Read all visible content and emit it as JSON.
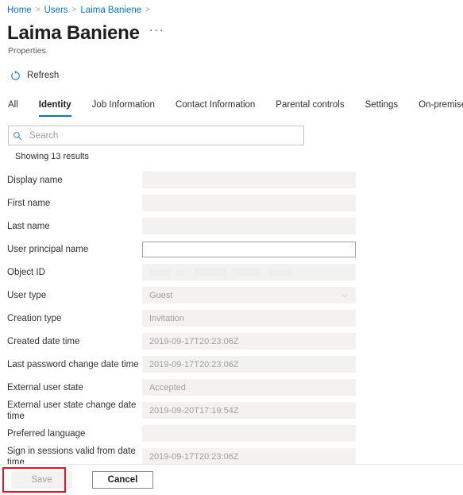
{
  "breadcrumb": {
    "items": [
      "Home",
      "Users",
      "Laima Baniene"
    ],
    "separator": ">"
  },
  "header": {
    "title": "Laima Baniene",
    "subtitle": "Properties",
    "more_menu": "···"
  },
  "command_bar": {
    "refresh_label": "Refresh",
    "refresh_icon": "refresh-icon"
  },
  "tabs": [
    {
      "label": "All",
      "active": false
    },
    {
      "label": "Identity",
      "active": true
    },
    {
      "label": "Job Information",
      "active": false
    },
    {
      "label": "Contact Information",
      "active": false
    },
    {
      "label": "Parental controls",
      "active": false
    },
    {
      "label": "Settings",
      "active": false
    },
    {
      "label": "On-premises",
      "active": false
    }
  ],
  "search": {
    "placeholder": "Search",
    "value": "",
    "icon": "search-icon"
  },
  "results": {
    "count_text": "Showing 13 results"
  },
  "form": {
    "fields": [
      {
        "label": "Display name",
        "value": "",
        "type": "text",
        "disabled": true
      },
      {
        "label": "First name",
        "value": "",
        "type": "text",
        "disabled": true
      },
      {
        "label": "Last name",
        "value": "",
        "type": "text",
        "disabled": true
      },
      {
        "label": "User principal name",
        "value": "",
        "type": "text",
        "disabled": false
      },
      {
        "label": "Object ID",
        "value": "",
        "type": "redacted",
        "disabled": true
      },
      {
        "label": "User type",
        "value": "Guest",
        "type": "select",
        "disabled": true
      },
      {
        "label": "Creation type",
        "value": "Invitation",
        "type": "text",
        "disabled": true
      },
      {
        "label": "Created date time",
        "value": "2019-09-17T20:23:06Z",
        "type": "text",
        "disabled": true
      },
      {
        "label": "Last password change date time",
        "value": "2019-09-17T20:23:06Z",
        "type": "text",
        "disabled": true
      },
      {
        "label": "External user state",
        "value": "Accepted",
        "type": "text",
        "disabled": true
      },
      {
        "label": "External user state change date time",
        "value": "2019-09-20T17:19:54Z",
        "type": "text",
        "disabled": true
      },
      {
        "label": "Preferred language",
        "value": "",
        "type": "text",
        "disabled": true
      },
      {
        "label": "Sign in sessions valid from date time",
        "value": "2019-09-17T20:23:06Z",
        "type": "text",
        "disabled": true
      }
    ]
  },
  "footer": {
    "save_label": "Save",
    "cancel_label": "Cancel",
    "save_disabled": true
  },
  "colors": {
    "accent": "#0078d4",
    "link": "#0078d4",
    "text": "#323130",
    "disabled_text": "#a19f9d",
    "field_bg": "#f3f2f1",
    "border": "#c8c6c4",
    "highlight": "#e81123"
  }
}
